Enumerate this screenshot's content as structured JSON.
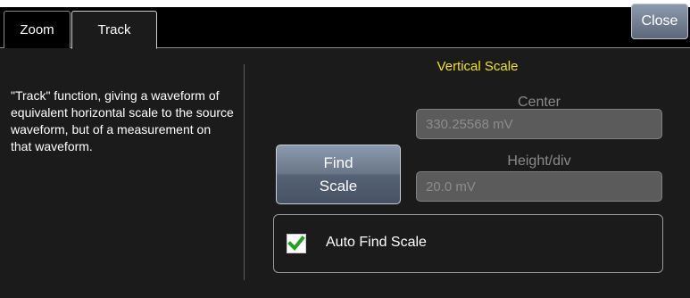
{
  "tabs": [
    {
      "label": "Zoom"
    },
    {
      "label": "Track"
    }
  ],
  "close_label": "Close",
  "description": "\"Track\" function, giving a waveform of equivalent horizontal scale to the source waveform, but of a measurement on that waveform.",
  "vertical_scale": {
    "title": "Vertical Scale",
    "center_label": "Center",
    "center_value": "330.25568 mV",
    "height_label": "Height/div",
    "height_value": "20.0 mV"
  },
  "find_scale": {
    "line1": "Find",
    "line2": "Scale"
  },
  "auto_find": {
    "label": "Auto Find Scale",
    "checked": true
  },
  "colors": {
    "title_yellow": "#f1e40a",
    "check_green": "#1fa31f"
  }
}
